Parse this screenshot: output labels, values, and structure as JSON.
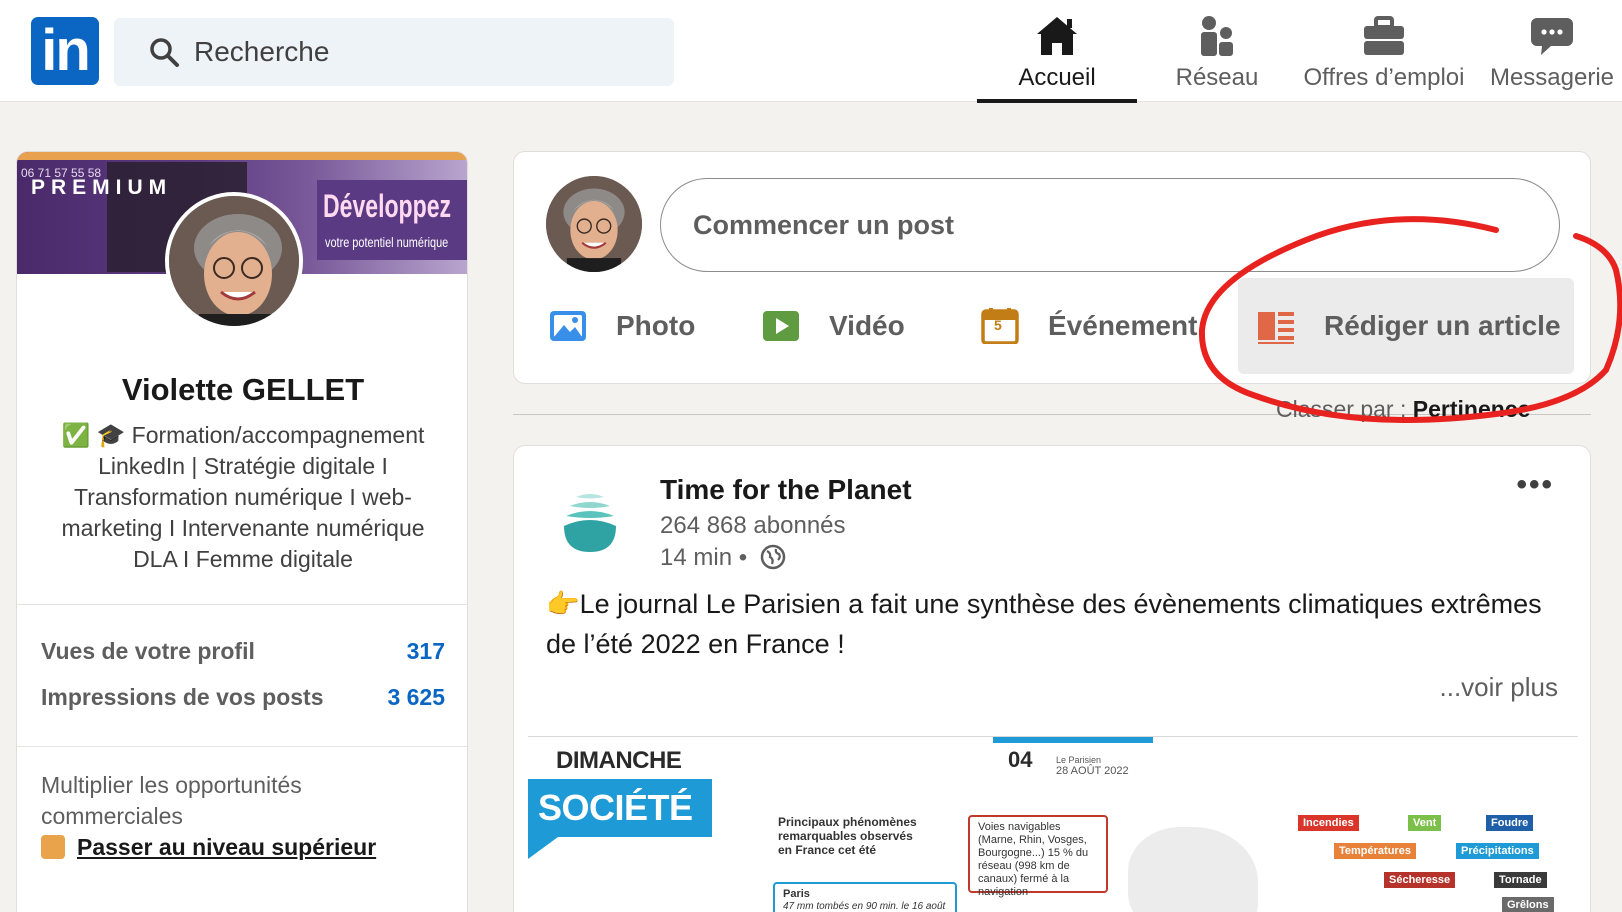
{
  "topbar": {
    "logo": "in",
    "search_placeholder": "Recherche",
    "nav": [
      {
        "label": "Accueil",
        "icon": "home-icon",
        "active": true
      },
      {
        "label": "Réseau",
        "icon": "network-icon",
        "active": false
      },
      {
        "label": "Offres d’emploi",
        "icon": "briefcase-icon",
        "active": false
      },
      {
        "label": "Messagerie",
        "icon": "messaging-icon",
        "active": false
      }
    ]
  },
  "profile": {
    "banner_premium": "PREMIUM",
    "banner_phone": "06 71 57 55 58",
    "banner_title": "Développez",
    "banner_subtitle": "votre potentiel numérique",
    "name": "Violette GELLET",
    "headline": "✅ 🎓 Formation/accompagnement LinkedIn | Stratégie digitale I Transformation numérique I web-marketing I Intervenante numérique DLA I Femme digitale",
    "stats": [
      {
        "label": "Vues de votre profil",
        "value": "317"
      },
      {
        "label": "Impressions de vos posts",
        "value": "3 625"
      }
    ],
    "promo_text": "Multiplier les opportunités commerciales",
    "upgrade_link": "Passer au niveau supérieur"
  },
  "share": {
    "start_post": "Commencer un post",
    "actions": [
      {
        "label": "Photo",
        "icon": "photo-icon",
        "color": "#378fe9"
      },
      {
        "label": "Vidéo",
        "icon": "video-icon",
        "color": "#5f9b41"
      },
      {
        "label": "Événement",
        "icon": "calendar-icon",
        "color": "#c37d16"
      },
      {
        "label": "Rédiger un article",
        "icon": "article-icon",
        "color": "#e06847"
      }
    ],
    "calendar_day": "5"
  },
  "sort": {
    "label": "Classer par :",
    "value": "Pertinence"
  },
  "post": {
    "author": "Time for the Planet",
    "followers": "264 868 abonnés",
    "time": "14 min •",
    "more": "•••",
    "text": "👉Le journal Le Parisien a fait une synthèse des évènements climatiques extrêmes de l’été 2022 en France !",
    "see_more": "...voir plus",
    "image": {
      "dimanche": "DIMANCHE",
      "societe": "SOCIÉTÉ",
      "page": "04",
      "paper": "Le Parisien",
      "date": "28 AOÛT 2022",
      "phenomena": "Principaux phénomènes remarquables observés en France cet été",
      "voies": "Voies navigables (Marne, Rhin, Vosges, Bourgogne...) 15 % du réseau (998 km de canaux) fermé à la navigation",
      "paris": "Paris",
      "paris_detail": "47 mm tombés en 90 min. le 16 août",
      "legend": [
        "Incendies",
        "Vent",
        "Foudre",
        "Températures",
        "Précipitations",
        "Sécheresse",
        "Tornade",
        "Grêlons"
      ]
    }
  },
  "colors": {
    "brand": "#0a66c2",
    "annotation": "#e8231f"
  }
}
